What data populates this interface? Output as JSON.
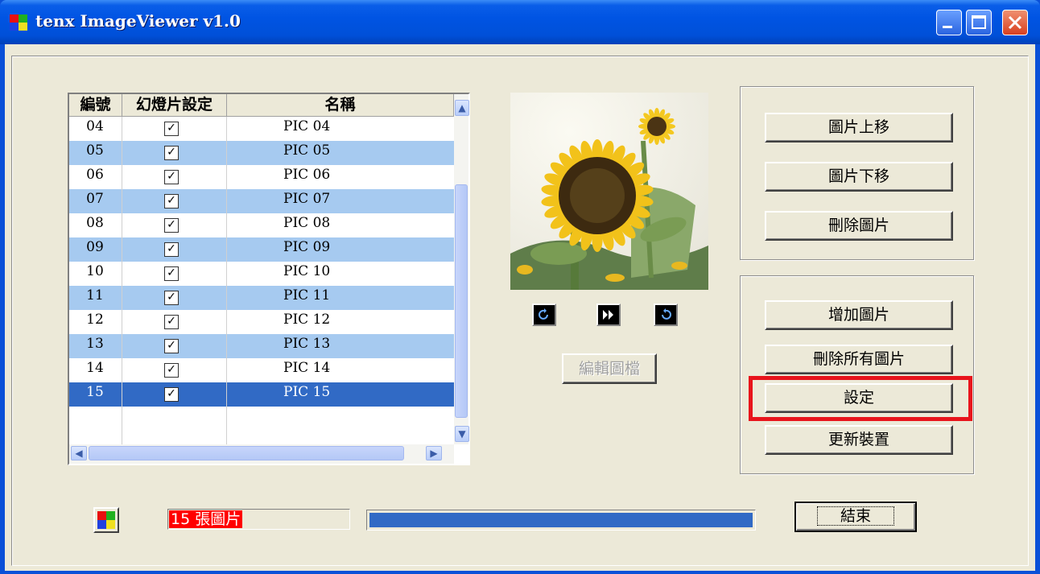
{
  "window": {
    "title": "tenx ImageViewer v1.0"
  },
  "list": {
    "columns": [
      "編號",
      "幻燈片設定",
      "名稱"
    ],
    "rows": [
      {
        "num": "04",
        "checked": true,
        "name": "PIC 04",
        "style": "normal"
      },
      {
        "num": "05",
        "checked": true,
        "name": "PIC 05",
        "style": "alt"
      },
      {
        "num": "06",
        "checked": true,
        "name": "PIC 06",
        "style": "normal"
      },
      {
        "num": "07",
        "checked": true,
        "name": "PIC 07",
        "style": "alt"
      },
      {
        "num": "08",
        "checked": true,
        "name": "PIC 08",
        "style": "normal"
      },
      {
        "num": "09",
        "checked": true,
        "name": "PIC 09",
        "style": "alt"
      },
      {
        "num": "10",
        "checked": true,
        "name": "PIC 10",
        "style": "normal"
      },
      {
        "num": "11",
        "checked": true,
        "name": "PIC 11",
        "style": "alt"
      },
      {
        "num": "12",
        "checked": true,
        "name": "PIC 12",
        "style": "normal"
      },
      {
        "num": "13",
        "checked": true,
        "name": "PIC 13",
        "style": "alt"
      },
      {
        "num": "14",
        "checked": true,
        "name": "PIC 14",
        "style": "normal"
      },
      {
        "num": "15",
        "checked": true,
        "name": "PIC 15",
        "style": "sel"
      }
    ],
    "check_glyph": "✓"
  },
  "preview": {
    "nav_icons": [
      "rotate-left-icon",
      "next-icon",
      "rotate-right-icon"
    ],
    "edit_label": "編輯圖檔"
  },
  "buttons": {
    "move_up": "圖片上移",
    "move_down": "圖片下移",
    "delete": "刪除圖片",
    "add": "增加圖片",
    "delete_all": "刪除所有圖片",
    "settings": "設定",
    "update_device": "更新裝置",
    "close": "結束"
  },
  "status": {
    "text": "15 張圖片",
    "progress": 1.0
  },
  "colors": {
    "highlight": "#e8141c",
    "selection": "#316ac5",
    "alt_row": "#a6caf0",
    "titlebar": "#0054e3"
  }
}
